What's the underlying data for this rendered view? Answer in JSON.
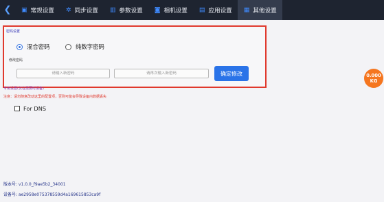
{
  "topbar": {
    "back_icon": "chevron-left-icon",
    "tabs": [
      {
        "label": "常规设置",
        "icon": "settings-doc-icon",
        "glyph": "▣"
      },
      {
        "label": "同步设置",
        "icon": "sync-gear-icon",
        "glyph": "✲"
      },
      {
        "label": "参数设置",
        "icon": "sliders-icon",
        "glyph": "▥"
      },
      {
        "label": "相机设置",
        "icon": "camera-icon",
        "glyph": "◙"
      },
      {
        "label": "应用设置",
        "icon": "app-folder-icon",
        "glyph": "▤"
      },
      {
        "label": "其他设置",
        "icon": "other-settings-icon",
        "glyph": "▦"
      }
    ],
    "active_tab": "其他设置"
  },
  "password_panel": {
    "title": "密码设置",
    "options": [
      {
        "label": "混合密码",
        "selected": true
      },
      {
        "label": "纯数字密码",
        "selected": false
      }
    ],
    "change_label": "修改密码",
    "new_password_placeholder": "请输入新密码",
    "confirm_password_placeholder": "请再次输入新密码",
    "confirm_button": "确定修改"
  },
  "weight_badge": {
    "value": "0.000",
    "unit": "KG"
  },
  "special_settings": {
    "title": "专用设置(仅在需要时设备)",
    "note": "注意：请勿随意改动这里的配置项，否则可能会导致设备内数据丢失",
    "for_dns_label": "For DNS",
    "for_dns_checked": false
  },
  "footer": {
    "version_label": "版本号: v1.0.0_f9ae5b2_34001",
    "device_label": "设备号: ae2958e075378559d4a169615853ca9f"
  },
  "colors": {
    "topbar_bg": "#1e2430",
    "accent_blue": "#2a73e8",
    "highlight_red": "#e0392d",
    "badge_orange": "#f5761f"
  }
}
